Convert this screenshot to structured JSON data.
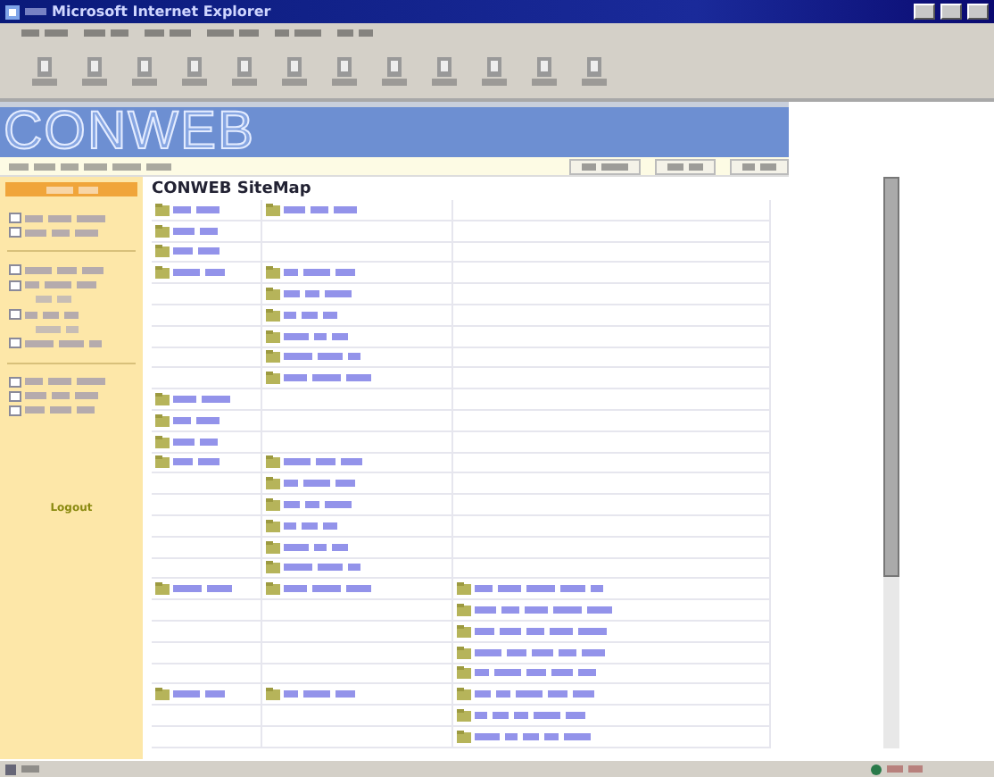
{
  "window": {
    "title": "Microsoft Internet Explorer"
  },
  "banner": {
    "logo": "CONWEB"
  },
  "sidebar": {
    "items": [
      {
        "kind": "item"
      },
      {
        "kind": "item"
      },
      {
        "kind": "divider"
      },
      {
        "kind": "item"
      },
      {
        "kind": "item"
      },
      {
        "kind": "subitem"
      },
      {
        "kind": "item"
      },
      {
        "kind": "subitem"
      },
      {
        "kind": "item"
      },
      {
        "kind": "divider"
      },
      {
        "kind": "item"
      },
      {
        "kind": "item"
      },
      {
        "kind": "item"
      }
    ],
    "logout": "Logout"
  },
  "sitemap": {
    "title": "CONWEB SiteMap",
    "rows": [
      {
        "cells": [
          {
            "link": true
          },
          {
            "link": true
          },
          {
            "link": false
          }
        ]
      },
      {
        "cells": [
          {
            "link": true
          },
          {
            "link": false
          },
          {
            "link": false
          }
        ]
      },
      {
        "cells": [
          {
            "link": true
          },
          {
            "link": false
          },
          {
            "link": false
          }
        ]
      },
      {
        "cells": [
          {
            "link": true
          },
          {
            "link": true
          },
          {
            "link": false
          }
        ]
      },
      {
        "cells": [
          {
            "link": false
          },
          {
            "link": true
          },
          {
            "link": false
          }
        ]
      },
      {
        "cells": [
          {
            "link": false
          },
          {
            "link": true
          },
          {
            "link": false
          }
        ]
      },
      {
        "cells": [
          {
            "link": false
          },
          {
            "link": true
          },
          {
            "link": false
          }
        ]
      },
      {
        "cells": [
          {
            "link": false
          },
          {
            "link": true
          },
          {
            "link": false
          }
        ]
      },
      {
        "cells": [
          {
            "link": false
          },
          {
            "link": true
          },
          {
            "link": false
          }
        ]
      },
      {
        "cells": [
          {
            "link": true
          },
          {
            "link": false
          },
          {
            "link": false
          }
        ]
      },
      {
        "cells": [
          {
            "link": true
          },
          {
            "link": false
          },
          {
            "link": false
          }
        ]
      },
      {
        "cells": [
          {
            "link": true
          },
          {
            "link": false
          },
          {
            "link": false
          }
        ]
      },
      {
        "cells": [
          {
            "link": true
          },
          {
            "link": true
          },
          {
            "link": false
          }
        ]
      },
      {
        "cells": [
          {
            "link": false
          },
          {
            "link": true
          },
          {
            "link": false
          }
        ]
      },
      {
        "cells": [
          {
            "link": false
          },
          {
            "link": true
          },
          {
            "link": false
          }
        ]
      },
      {
        "cells": [
          {
            "link": false
          },
          {
            "link": true
          },
          {
            "link": false
          }
        ]
      },
      {
        "cells": [
          {
            "link": false
          },
          {
            "link": true
          },
          {
            "link": false
          }
        ]
      },
      {
        "cells": [
          {
            "link": false
          },
          {
            "link": true
          },
          {
            "link": false
          }
        ]
      },
      {
        "cells": [
          {
            "link": true
          },
          {
            "link": true
          },
          {
            "link": true
          }
        ]
      },
      {
        "cells": [
          {
            "link": false
          },
          {
            "link": false
          },
          {
            "link": true
          }
        ]
      },
      {
        "cells": [
          {
            "link": false
          },
          {
            "link": false
          },
          {
            "link": true
          }
        ]
      },
      {
        "cells": [
          {
            "link": false
          },
          {
            "link": false
          },
          {
            "link": true
          }
        ]
      },
      {
        "cells": [
          {
            "link": false
          },
          {
            "link": false
          },
          {
            "link": true
          }
        ]
      },
      {
        "cells": [
          {
            "link": true
          },
          {
            "link": true
          },
          {
            "link": true
          }
        ]
      },
      {
        "cells": [
          {
            "link": false
          },
          {
            "link": false
          },
          {
            "link": true
          }
        ]
      },
      {
        "cells": [
          {
            "link": false
          },
          {
            "link": false
          },
          {
            "link": true
          }
        ]
      }
    ]
  }
}
